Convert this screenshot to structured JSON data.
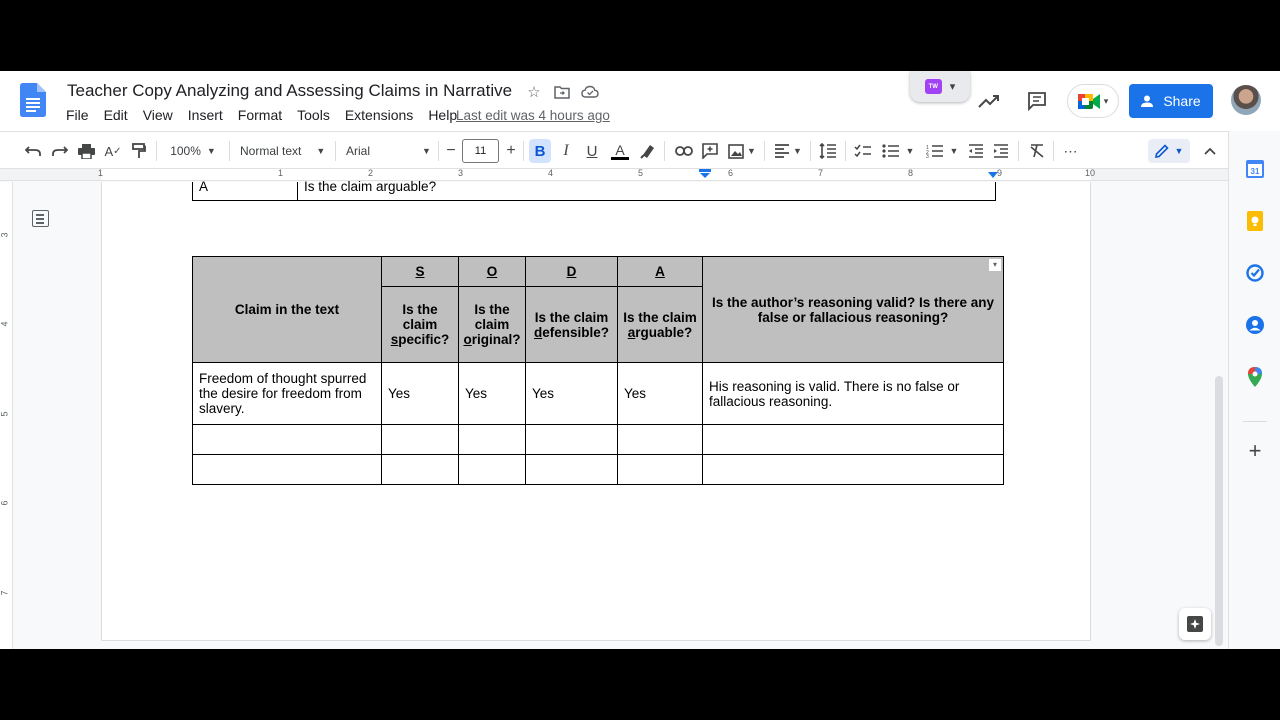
{
  "doc": {
    "title": "Teacher Copy Analyzing and Assessing Claims in Narrative",
    "last_edit": "Last edit was 4 hours ago",
    "share_label": "Share"
  },
  "menu": [
    "File",
    "Edit",
    "View",
    "Insert",
    "Format",
    "Tools",
    "Extensions",
    "Help"
  ],
  "toolbar": {
    "zoom": "100%",
    "style": "Normal text",
    "font": "Arial",
    "font_size": "11",
    "bold": "B",
    "italic": "I",
    "underline": "U",
    "text_color": "A",
    "minus": "−",
    "plus": "+"
  },
  "addon": {
    "badge": "TW"
  },
  "ruler": {
    "h_numbers": [
      "1",
      "1",
      "2",
      "3",
      "4",
      "5",
      "6",
      "7",
      "8",
      "9",
      "10"
    ],
    "v_numbers": [
      "3",
      "4",
      "5",
      "6",
      "7"
    ]
  },
  "prev_row": {
    "letter": "A",
    "question": "Is the claim arguable?"
  },
  "table": {
    "claim_header": "Claim in the text",
    "letters": [
      "S",
      "O",
      "D",
      "A"
    ],
    "questions": [
      {
        "pre": "Is the claim ",
        "u": "s",
        "post": "pecific?"
      },
      {
        "pre": "Is the claim ",
        "u": "o",
        "post": "riginal?"
      },
      {
        "pre": "Is the claim ",
        "u": "d",
        "post": "efensible?"
      },
      {
        "pre": "Is the claim ",
        "u": "a",
        "post": "rguable?"
      }
    ],
    "reasoning_header": "Is the author’s reasoning valid?  Is there any false or fallacious reasoning?",
    "rows": [
      {
        "claim": "Freedom of thought spurred the desire for freedom from slavery.",
        "s": "Yes",
        "o": "Yes",
        "d": "Yes",
        "a": "Yes",
        "reasoning": "His reasoning is valid.  There is no false or fallacious reasoning."
      },
      {
        "claim": "",
        "s": "",
        "o": "",
        "d": "",
        "a": "",
        "reasoning": ""
      },
      {
        "claim": "",
        "s": "",
        "o": "",
        "d": "",
        "a": "",
        "reasoning": ""
      }
    ]
  },
  "colors": {
    "accent": "#1a73e8",
    "header_fill": "#bfbfbf",
    "bold_active": "#d3e3fd"
  }
}
